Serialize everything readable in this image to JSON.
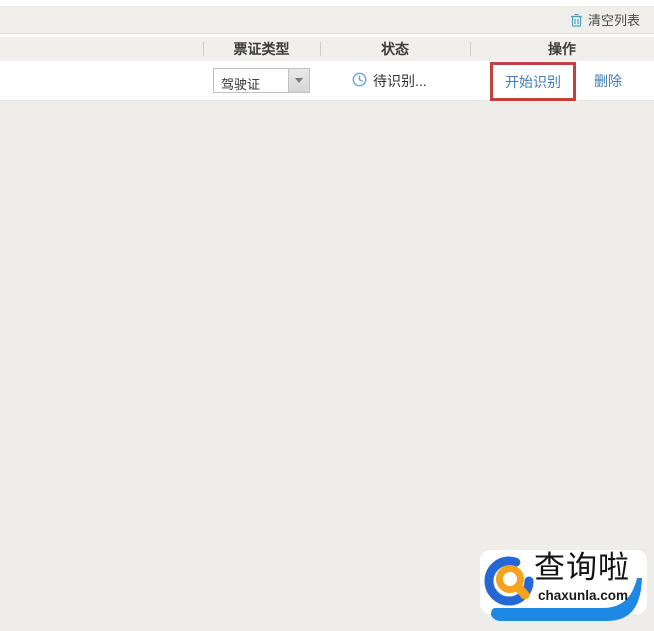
{
  "toolbar": {
    "clear_list": {
      "label": "清空列表",
      "icon": "trash-icon"
    }
  },
  "table": {
    "columns": [
      {
        "id": "type",
        "label": "票证类型"
      },
      {
        "id": "status",
        "label": "状态"
      },
      {
        "id": "actions",
        "label": "操作"
      }
    ],
    "rows": [
      {
        "type_selected": "驾驶证",
        "status_icon": "clock-icon",
        "status_text": "待识别...",
        "start_label": "开始识别",
        "start_highlighted": true,
        "delete_label": "删除"
      }
    ]
  },
  "watermark": {
    "brand_text": "查询啦",
    "domain_text": "chaxunla.com",
    "icon": "magnifier-logo-icon"
  },
  "colors": {
    "link_blue": "#3f7cb6",
    "annotation_red": "#c0413f",
    "trash_icon_teal": "#4aa3c4",
    "clock_icon_blue": "#6aa3d8",
    "toolbar_bg": "#f0eeeb",
    "header_bg": "#f1efec",
    "empty_area_bg": "#efedea",
    "logo_ring_blue": "#2667d6",
    "logo_magnifier_orange": "#f6a21d",
    "logo_swoosh_blue": "#1e88e5"
  }
}
